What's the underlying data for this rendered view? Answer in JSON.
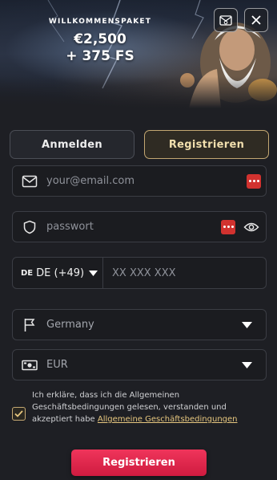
{
  "banner": {
    "subtitle": "WILLKOMMENSPAKET",
    "amount": "€2,500",
    "bonus": "+ 375 FS"
  },
  "header_icons": {
    "mail": "mail-icon",
    "close": "close-icon"
  },
  "tabs": [
    {
      "label": "Anmelden",
      "active": false
    },
    {
      "label": "Registrieren",
      "active": true
    }
  ],
  "form": {
    "email": {
      "placeholder": "your@email.com",
      "value": "",
      "icon": "mail-icon"
    },
    "password": {
      "placeholder": "passwort",
      "value": "",
      "icon": "shield-icon"
    },
    "phone": {
      "country_flag": "DE",
      "country_code": "DE (+49)",
      "placeholder": "XX XXX XXX",
      "value": ""
    },
    "country": {
      "value": "Germany",
      "icon": "flag-icon"
    },
    "currency": {
      "value": "EUR",
      "icon": "banknote-icon"
    },
    "terms": {
      "checked": true,
      "text": "Ich erkläre, dass ich die Allgemeinen Geschäftsbedingungen gelesen, verstanden und akzeptiert habe",
      "link": "Allgemeine Geschäftsbedingungen"
    },
    "submit_label": "Registrieren"
  },
  "colors": {
    "accent_gold": "#c3a772",
    "submit_red": "#e02a4f",
    "background": "#1e1f24",
    "password_manager_badge": "#d1322f"
  }
}
